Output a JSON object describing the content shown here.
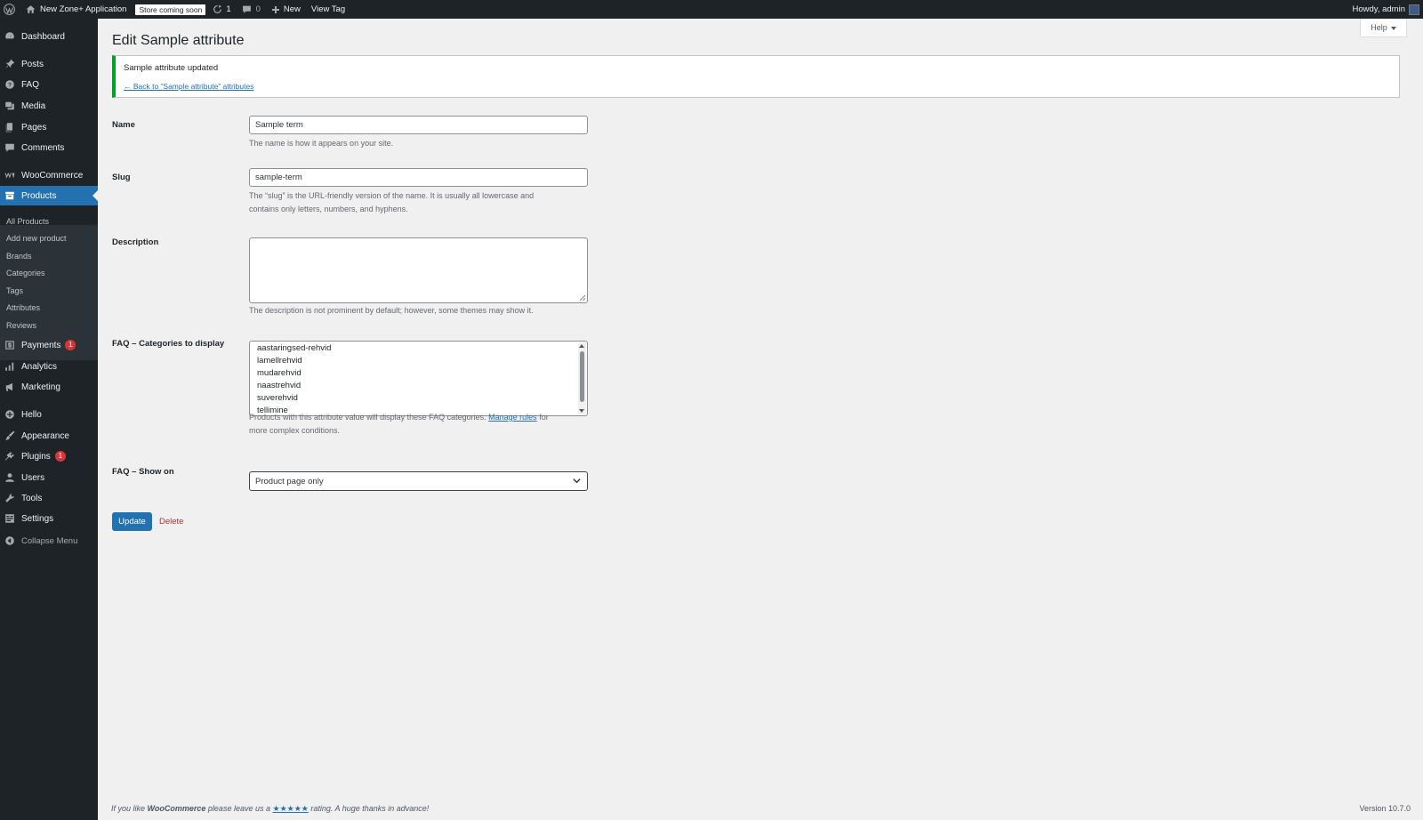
{
  "adminbar": {
    "site_name": "New Zone+ Application",
    "store_badge": "Store coming soon",
    "updates_count": "1",
    "comments_count": "0",
    "new_label": "New",
    "view_tag_label": "View Tag",
    "howdy": "Howdy, admin"
  },
  "sidebar": {
    "dashboard": "Dashboard",
    "posts": "Posts",
    "faq": "FAQ",
    "media": "Media",
    "pages": "Pages",
    "comments": "Comments",
    "woocommerce": "WooCommerce",
    "products": "Products",
    "submenu": {
      "all_products": "All Products",
      "add_new_product": "Add new product",
      "brands": "Brands",
      "categories": "Categories",
      "tags": "Tags",
      "attributes": "Attributes",
      "reviews": "Reviews"
    },
    "payments": "Payments",
    "payments_count": "1",
    "analytics": "Analytics",
    "marketing": "Marketing",
    "hello": "Hello",
    "appearance": "Appearance",
    "plugins": "Plugins",
    "plugins_count": "1",
    "users": "Users",
    "tools": "Tools",
    "settings": "Settings",
    "collapse": "Collapse Menu"
  },
  "page": {
    "title": "Edit Sample attribute",
    "help_label": "Help",
    "notice_message": "Sample attribute updated",
    "notice_back_link": "← Back to “Sample attribute” attributes"
  },
  "form": {
    "name_label": "Name",
    "name_value": "Sample term",
    "name_desc": "The name is how it appears on your site.",
    "slug_label": "Slug",
    "slug_value": "sample-term",
    "slug_desc_line1": "The “slug” is the URL-friendly version of the name. It is usually all lowercase and",
    "slug_desc_line2": "contains only letters, numbers, and hyphens.",
    "description_label": "Description",
    "description_desc": "The description is not prominent by default; however, some themes may show it.",
    "faq_categories_label": "FAQ – Categories to display",
    "faq_categories_options": [
      "aastaringsed-rehvid",
      "lamellrehvid",
      "mudarehvid",
      "naastrehvid",
      "suverehvid",
      "tellimine"
    ],
    "faq_categories_desc_before": "Products with this attribute value will display these FAQ categories.",
    "faq_categories_manage_link": "Manage rules",
    "faq_categories_desc_after": "for",
    "faq_categories_desc_line2": "more complex conditions.",
    "faq_show_on_label": "FAQ – Show on",
    "faq_show_on_value": "Product page only",
    "update_button": "Update",
    "delete_link": "Delete"
  },
  "footer": {
    "left_prefix": "If you like",
    "left_brand": "WooCommerce",
    "left_mid": "please leave us a",
    "left_stars": "★★★★★",
    "left_suffix": "rating. A huge thanks in advance!",
    "version": "Version 10.7.0"
  },
  "colors": {
    "adminbar_bg": "#1d2327",
    "accent": "#2271b1",
    "success": "#00a32a",
    "danger": "#d63638"
  }
}
